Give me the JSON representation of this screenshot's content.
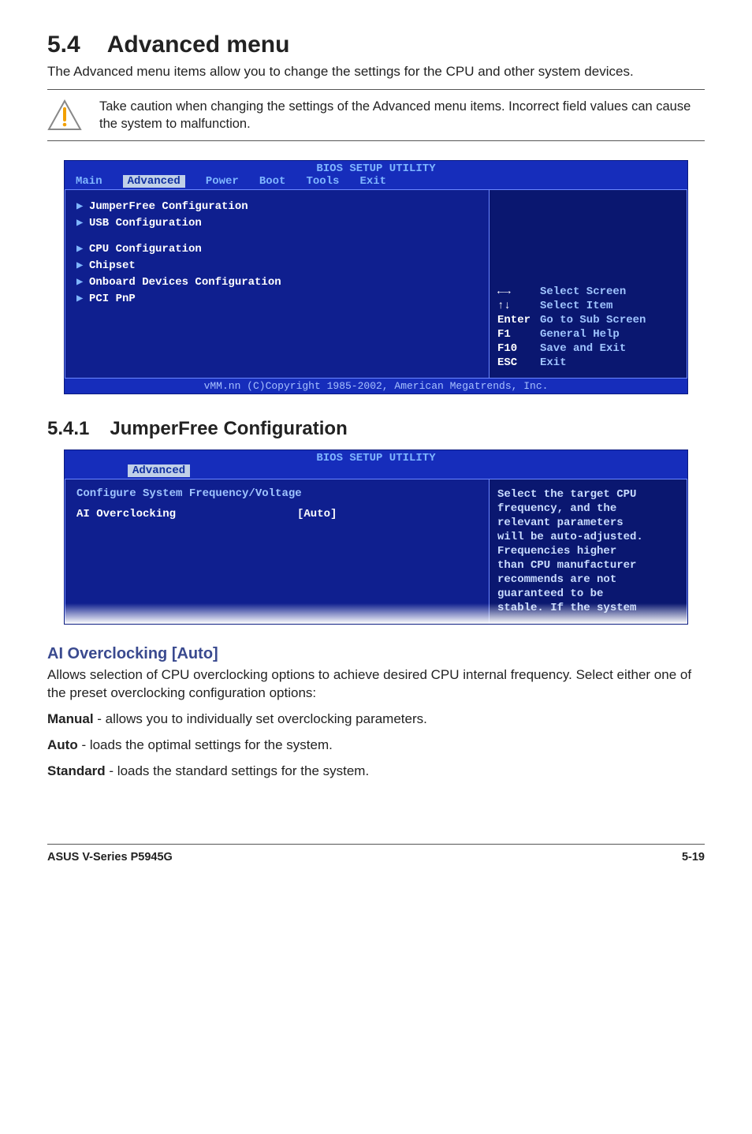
{
  "section": {
    "number": "5.4",
    "title": "Advanced menu",
    "intro": "The Advanced menu items allow you to change the settings for the CPU and other system devices."
  },
  "caution": "Take caution when changing the settings of the Advanced menu items. Incorrect field values can cause the system to malfunction.",
  "bios1": {
    "title": "BIOS SETUP UTILITY",
    "tabs": [
      "Main",
      "Advanced",
      "Power",
      "Boot",
      "Tools",
      "Exit"
    ],
    "active_tab": "Advanced",
    "menu_top": [
      "JumperFree Configuration",
      "USB Configuration"
    ],
    "menu_bottom": [
      "CPU Configuration",
      "Chipset",
      "Onboard Devices Configuration",
      "PCI PnP"
    ],
    "hints": [
      {
        "key": "←→",
        "label": "Select Screen"
      },
      {
        "key": "↑↓",
        "label": "Select Item"
      },
      {
        "key": "Enter",
        "label": "Go to Sub Screen"
      },
      {
        "key": "F1",
        "label": "General Help"
      },
      {
        "key": "F10",
        "label": "Save and Exit"
      },
      {
        "key": "ESC",
        "label": "Exit"
      }
    ],
    "footer": "vMM.nn (C)Copyright 1985-2002, American Megatrends, Inc."
  },
  "subsection": {
    "number": "5.4.1",
    "title": "JumperFree Configuration"
  },
  "bios2": {
    "title": "BIOS SETUP UTILITY",
    "tab": "Advanced",
    "config_header": "Configure System Frequency/Voltage",
    "row_label": "AI Overclocking",
    "row_value": "[Auto]",
    "help": [
      "Select the target CPU",
      "frequency, and the",
      "relevant parameters",
      "will be auto-adjusted.",
      "Frequencies higher",
      "than CPU manufacturer",
      "recommends are not",
      "guaranteed to be",
      "stable. If the system"
    ]
  },
  "ai_over": {
    "heading": "AI Overclocking [Auto]",
    "para": "Allows selection of CPU overclocking options to achieve desired CPU internal frequency. Select either one of the preset overclocking configuration options:",
    "manual_label": "Manual",
    "manual_text": " - allows you to individually set overclocking parameters.",
    "auto_label": "Auto",
    "auto_text": " - loads the optimal settings for the system.",
    "standard_label": "Standard",
    "standard_text": " - loads the standard settings for the system."
  },
  "footer": {
    "left": "ASUS V-Series P5945G",
    "right": "5-19"
  },
  "chart_data": {
    "type": "table",
    "title": "BIOS Advanced Menu Items",
    "rows": [
      {
        "group": "top",
        "item": "JumperFree Configuration"
      },
      {
        "group": "top",
        "item": "USB Configuration"
      },
      {
        "group": "bottom",
        "item": "CPU Configuration"
      },
      {
        "group": "bottom",
        "item": "Chipset"
      },
      {
        "group": "bottom",
        "item": "Onboard Devices Configuration"
      },
      {
        "group": "bottom",
        "item": "PCI PnP"
      }
    ],
    "config_item": {
      "name": "AI Overclocking",
      "value": "Auto"
    }
  }
}
